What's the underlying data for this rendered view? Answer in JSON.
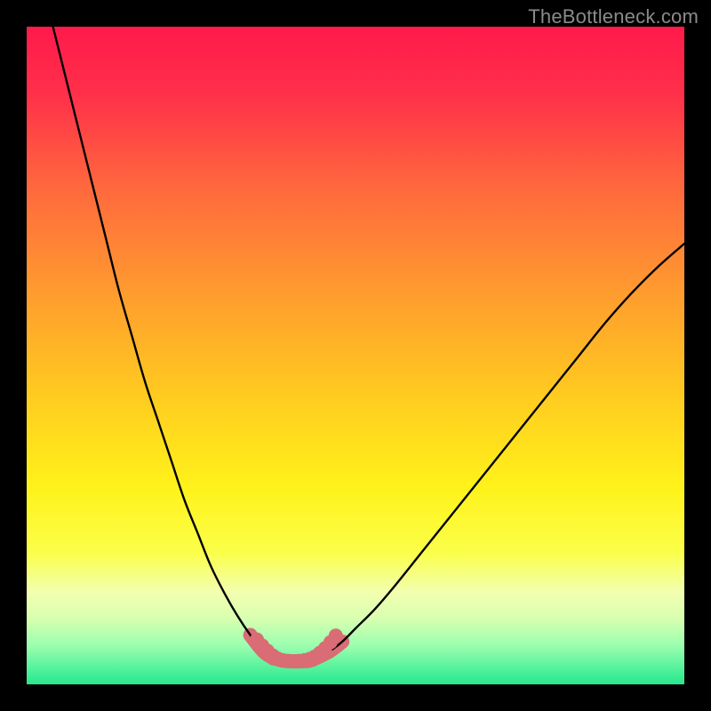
{
  "watermark": "TheBottleneck.com",
  "colors": {
    "black": "#000000",
    "curve": "#000000",
    "marker": "#d96c74",
    "gradient_stops": [
      {
        "offset": 0.0,
        "color": "#ff1a4b"
      },
      {
        "offset": 0.1,
        "color": "#ff2f4a"
      },
      {
        "offset": 0.25,
        "color": "#ff6a3d"
      },
      {
        "offset": 0.4,
        "color": "#ff9a2f"
      },
      {
        "offset": 0.55,
        "color": "#ffc820"
      },
      {
        "offset": 0.7,
        "color": "#fff21a"
      },
      {
        "offset": 0.8,
        "color": "#fbff4a"
      },
      {
        "offset": 0.86,
        "color": "#f2ffb0"
      },
      {
        "offset": 0.9,
        "color": "#d8ffb0"
      },
      {
        "offset": 0.94,
        "color": "#9dffb0"
      },
      {
        "offset": 1.0,
        "color": "#24e88f"
      }
    ]
  },
  "chart_data": {
    "type": "line",
    "title": "",
    "xlabel": "",
    "ylabel": "",
    "xlim": [
      0,
      100
    ],
    "ylim": [
      0,
      100
    ],
    "series": [
      {
        "name": "left-curve",
        "x": [
          4,
          6,
          8,
          10,
          12,
          14,
          16,
          18,
          20,
          22,
          24,
          26,
          28,
          30,
          32,
          34,
          36,
          37.5
        ],
        "y": [
          100,
          92,
          84,
          76,
          68,
          60,
          53,
          46,
          40,
          34,
          28,
          23,
          18,
          14,
          10.5,
          7.5,
          5,
          4
        ]
      },
      {
        "name": "right-curve",
        "x": [
          44,
          46,
          48,
          50,
          53,
          56,
          60,
          64,
          68,
          72,
          76,
          80,
          84,
          88,
          92,
          96,
          100
        ],
        "y": [
          4,
          5,
          6.5,
          8.5,
          11.5,
          15,
          20,
          25,
          30,
          35,
          40,
          45,
          50,
          55,
          59.5,
          63.5,
          67
        ]
      },
      {
        "name": "valley-floor",
        "x": [
          37.5,
          39,
          41,
          43,
          44
        ],
        "y": [
          4,
          3.6,
          3.5,
          3.6,
          4
        ]
      }
    ],
    "markers": {
      "name": "highlight-dots",
      "points": [
        {
          "x": 35.0,
          "y": 6.8
        },
        {
          "x": 35.8,
          "y": 5.9
        },
        {
          "x": 36.6,
          "y": 5.1
        },
        {
          "x": 37.4,
          "y": 4.4
        },
        {
          "x": 38.2,
          "y": 3.9
        },
        {
          "x": 39.0,
          "y": 3.65
        },
        {
          "x": 39.8,
          "y": 3.55
        },
        {
          "x": 40.6,
          "y": 3.5
        },
        {
          "x": 41.4,
          "y": 3.55
        },
        {
          "x": 42.2,
          "y": 3.65
        },
        {
          "x": 43.0,
          "y": 3.85
        },
        {
          "x": 43.8,
          "y": 4.2
        },
        {
          "x": 44.6,
          "y": 4.8
        },
        {
          "x": 45.4,
          "y": 5.5
        },
        {
          "x": 46.2,
          "y": 6.4
        },
        {
          "x": 47.0,
          "y": 7.4
        }
      ]
    }
  }
}
